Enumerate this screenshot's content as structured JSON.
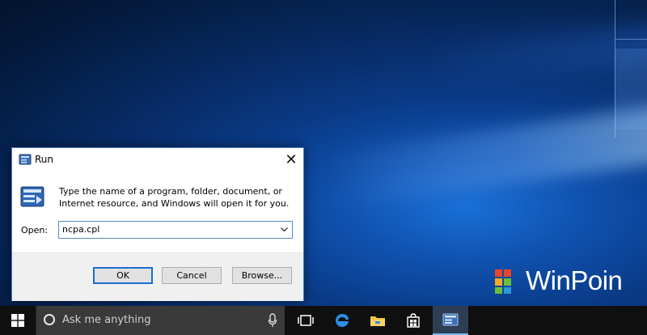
{
  "dialog": {
    "title": "Run",
    "description": "Type the name of a program, folder, document, or Internet resource, and Windows will open it for you.",
    "open_label": "Open:",
    "open_value": "ncpa.cpl",
    "ok_label": "OK",
    "cancel_label": "Cancel",
    "browse_label": "Browse...",
    "close_glyph": "✕"
  },
  "watermark": {
    "text": "WinPoin"
  },
  "taskbar": {
    "search_placeholder": "Ask me anything",
    "pinned_apps": [
      "task-view",
      "edge",
      "file-explorer",
      "store",
      "run"
    ]
  },
  "colors": {
    "accent": "#1a6fcf",
    "taskbar": "#101010",
    "dialog_bg": "#ffffff",
    "button_bar": "#f0f0f0"
  }
}
